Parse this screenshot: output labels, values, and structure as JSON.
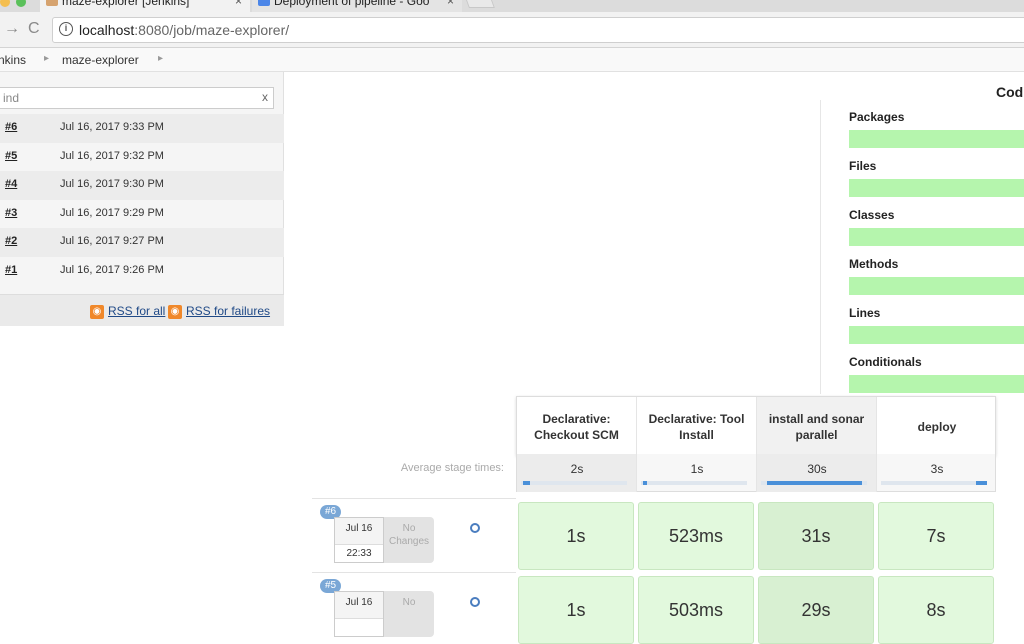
{
  "browser": {
    "tabs": [
      {
        "title": "maze-explorer [Jenkins]",
        "close": "×"
      },
      {
        "title": "Deployment of pipeline - Goo",
        "close": "×"
      }
    ],
    "nav": {
      "back": "→",
      "reload": "C"
    },
    "url_host": "localhost",
    "url_path": ":8080/job/maze-explorer/"
  },
  "breadcrumb": {
    "items": [
      "nkins",
      "maze-explorer"
    ],
    "separator": "▸"
  },
  "build_history": {
    "find_placeholder": "ind",
    "clear": "x",
    "builds": [
      {
        "number": "#6",
        "date": "Jul 16, 2017 9:33 PM"
      },
      {
        "number": "#5",
        "date": "Jul 16, 2017 9:32 PM"
      },
      {
        "number": "#4",
        "date": "Jul 16, 2017 9:30 PM"
      },
      {
        "number": "#3",
        "date": "Jul 16, 2017 9:29 PM"
      },
      {
        "number": "#2",
        "date": "Jul 16, 2017 9:27 PM"
      },
      {
        "number": "#1",
        "date": "Jul 16, 2017 9:26 PM"
      }
    ],
    "rss_all": "RSS for all",
    "rss_failures": "RSS for failures"
  },
  "coverage": {
    "title": "Cod",
    "items": [
      "Packages",
      "Files",
      "Classes",
      "Methods",
      "Lines",
      "Conditionals"
    ]
  },
  "stage_view": {
    "stages": [
      {
        "name": "Declarative: Checkout SCM",
        "avg": "2s",
        "avg_fraction": 0.07
      },
      {
        "name": "Declarative: Tool Install",
        "avg": "1s",
        "avg_fraction": 0.03
      },
      {
        "name": "install and sonar parallel",
        "avg": "30s",
        "avg_fraction": 0.9
      },
      {
        "name": "deploy",
        "avg": "3s",
        "avg_fraction": 0.1
      }
    ],
    "avg_label": "Average stage times:",
    "runs": [
      {
        "badge": "#6",
        "date": "Jul 16",
        "time": "22:33",
        "changes": "No Changes",
        "cells": [
          "1s",
          "523ms",
          "31s",
          "7s"
        ]
      },
      {
        "badge": "#5",
        "date": "Jul 16",
        "time": "",
        "changes": "No",
        "cells": [
          "1s",
          "503ms",
          "29s",
          "8s"
        ]
      }
    ]
  }
}
